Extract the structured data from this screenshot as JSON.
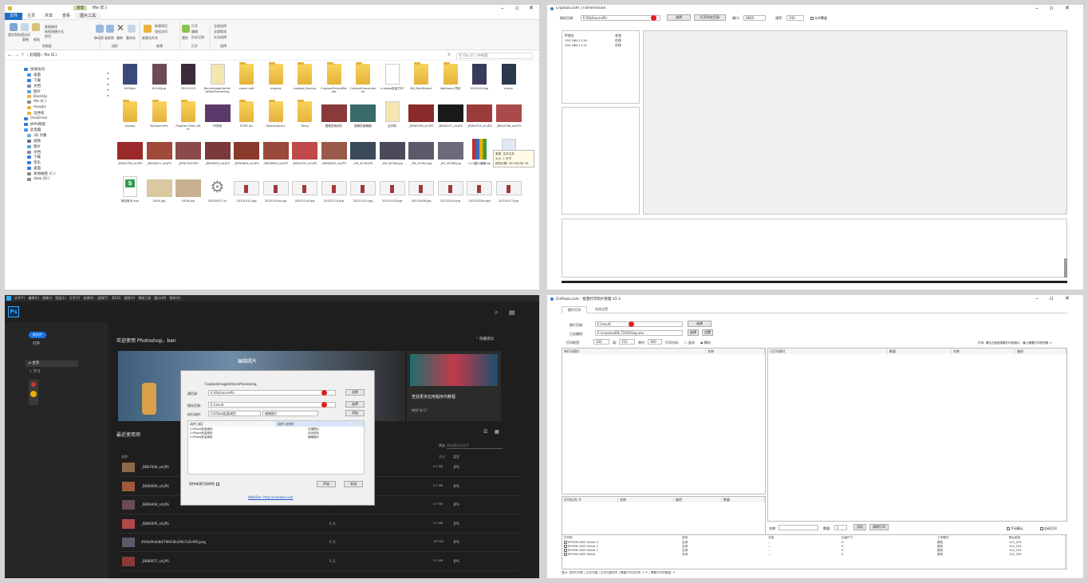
{
  "explorer": {
    "window_title": "file (E:)",
    "manage_tab": "管理",
    "ribbon_tabs": [
      "文件",
      "主页",
      "共享",
      "查看",
      "图片工具"
    ],
    "ribbon_groups": [
      "剪贴板",
      "组织",
      "新建",
      "打开",
      "选择"
    ],
    "ribbon_buttons": [
      "固定到快速访问",
      "复制",
      "粘贴",
      "复制路径",
      "粘贴快捷方式",
      "剪切",
      "移动到",
      "复制到",
      "删除",
      "重命名",
      "新建文件夹",
      "新建项目",
      "轻松访问",
      "属性",
      "打开",
      "编辑",
      "历史记录",
      "全部选择",
      "全部取消",
      "反向选择"
    ],
    "address": "› 此电脑 › file (E:)",
    "search_placeholder": "在 file (E:) 中搜索",
    "nav_items": [
      "快速访问",
      "桌面",
      "下载",
      "文档",
      "图片",
      "BackUp",
      "file (E:)",
      "mysqls",
      "证件照",
      "OneDrive",
      "WPS网盘",
      "此电脑",
      "3D 对象",
      "视频",
      "图片",
      "文档",
      "下载",
      "音乐",
      "桌面",
      "本地磁盘 (C:)",
      "data (D:)"
    ],
    "files": [
      {
        "name": "9090pic",
        "kind": "photo",
        "color": "#3b4a7a"
      },
      {
        "name": "80100jpg",
        "kind": "photo",
        "color": "#6b4a5a"
      },
      {
        "name": "20201219",
        "kind": "photo",
        "color": "#3a2a3a"
      },
      {
        "name": "BenlyImageOptimizationProcessing",
        "kind": "doc",
        "color": "#f3e6b0"
      },
      {
        "name": "canon soft",
        "kind": "folder",
        "color": "#e6b23a"
      },
      {
        "name": "cnplaza",
        "kind": "folder",
        "color": "#e6b23a"
      },
      {
        "name": "cnplaza_Backup",
        "kind": "folder",
        "color": "#e6b23a"
      },
      {
        "name": "CnplazaPictureRotate",
        "kind": "folder",
        "color": "#e6b23a"
      },
      {
        "name": "CnplazaTransmission",
        "kind": "folder",
        "color": "#e6b23a"
      },
      {
        "name": "cnplaza批量打印",
        "kind": "doc",
        "color": "#ffffff"
      },
      {
        "name": "DB_FaceDetect",
        "kind": "folder",
        "color": "#e6b23a"
      },
      {
        "name": "lightroom 预设",
        "kind": "folder",
        "color": "#e6b23a"
      },
      {
        "name": "M100100jpg",
        "kind": "photo",
        "color": "#3a3a5a"
      },
      {
        "name": "movie",
        "kind": "photo",
        "color": "#2a3a4a"
      },
      {
        "name": "mysqls",
        "kind": "folder",
        "color": "#e6b23a"
      },
      {
        "name": "MySourcePic",
        "kind": "folder",
        "color": "#e6b23a"
      },
      {
        "name": "Program Files (x86)",
        "kind": "folder",
        "color": "#e6b23a"
      },
      {
        "name": "PS预设",
        "kind": "photo",
        "color": "#5a3a6a"
      },
      {
        "name": "SONY pic",
        "kind": "folder",
        "color": "#e6b23a"
      },
      {
        "name": "SteamLibrary",
        "kind": "folder",
        "color": "#e6b23a"
      },
      {
        "name": "Temp",
        "kind": "folder",
        "color": "#e6b23a"
      },
      {
        "name": "图像匠精选件",
        "kind": "photo",
        "color": "#8a3a3a"
      },
      {
        "name": "图像匠编辑器",
        "kind": "photo",
        "color": "#3a6a6a"
      },
      {
        "name": "证件照",
        "kind": "doc",
        "color": "#f3e6b0"
      },
      {
        "name": "_BEN0198_sd.JPG",
        "kind": "photo",
        "color": "#8a2a2a"
      },
      {
        "name": "_BEN0247_sd.JPG",
        "kind": "photo",
        "color": "#1a1a1a"
      },
      {
        "name": "_BEN4751_sd.JPG",
        "kind": "photo",
        "color": "#9a3a3a"
      },
      {
        "name": "_BEN4788_sd.JPG",
        "kind": "photo",
        "color": "#aa4a4a"
      },
      {
        "name": "_BEN4798_sd.JPG",
        "kind": "photo",
        "color": "#9a2a2a"
      },
      {
        "name": "_BEN4821_sd.JPG",
        "kind": "photo",
        "color": "#a04a3a"
      },
      {
        "name": "_BEN7536.JPG",
        "kind": "photo",
        "color": "#8a4a4a"
      },
      {
        "name": "_BEN4803_sd.JPG",
        "kind": "photo",
        "color": "#7a3a3a"
      },
      {
        "name": "_BEN4804_sd.JPG",
        "kind": "photo",
        "color": "#8a3a2a"
      },
      {
        "name": "_BEN4805_sd.JPG",
        "kind": "photo",
        "color": "#9a4a3a"
      },
      {
        "name": "_BEN4790_sd.JPG",
        "kind": "photo",
        "color": "#c04a4a"
      },
      {
        "name": "_BEN4802_sd.JPG",
        "kind": "photo",
        "color": "#9a5a4a"
      },
      {
        "name": "_EN_4576.JPG",
        "kind": "photo",
        "color": "#3a4a5a"
      },
      {
        "name": "_EN_4576d.jpg",
        "kind": "photo",
        "color": "#4a4a5a"
      },
      {
        "name": "_EN_4578d.jpg",
        "kind": "photo",
        "color": "#5a5a6a"
      },
      {
        "name": "_EN_4578B.jpg",
        "kind": "photo",
        "color": "#6a6a7a"
      },
      {
        "name": "11.0图片编辑.zip",
        "kind": "zip",
        "color": "#c03030"
      },
      {
        "name": "16516812563a1",
        "kind": "doc",
        "color": "#dfe8f3"
      },
      {
        "name": "网站首页.xlsx",
        "kind": "xls",
        "color": "#2e9e4e"
      },
      {
        "name": "0426.jpg",
        "kind": "photo",
        "color": "#d9c8a0"
      },
      {
        "name": "0428.jpg",
        "kind": "photo",
        "color": "#c8b090"
      },
      {
        "name": "20200927.ini",
        "kind": "gear",
        "color": "#999999"
      },
      {
        "name": "20201010.jpg",
        "kind": "shot",
        "color": "#eeeeee"
      },
      {
        "name": "20201010a.jpg",
        "kind": "shot",
        "color": "#eeeeee"
      },
      {
        "name": "20201216.jpg",
        "kind": "shot",
        "color": "#eeeeee"
      },
      {
        "name": "20201219.jpg",
        "kind": "shot",
        "color": "#eeeeee"
      },
      {
        "name": "20210102.jpg",
        "kind": "shot",
        "color": "#eeeeee"
      },
      {
        "name": "20210103.jpg",
        "kind": "shot",
        "color": "#eeeeee"
      },
      {
        "name": "20210308.jpg",
        "kind": "shot",
        "color": "#eeeeee"
      },
      {
        "name": "20210324.jpg",
        "kind": "shot",
        "color": "#eeeeee"
      },
      {
        "name": "20210324a.jpg",
        "kind": "shot",
        "color": "#eeeeee"
      },
      {
        "name": "20210517.jpg",
        "kind": "shot",
        "color": "#eeeeee"
      }
    ],
    "tooltip": [
      "类型: 文本文件",
      "大小: 2 字节",
      "修改日期: 2019/6/08 16:"
    ]
  },
  "transmission": {
    "title": "Cnplaza.com | Transmission",
    "save_dir_label": "保存目录:",
    "save_dir_value": "E:\\MySourcePic",
    "select_btn": "选择",
    "open_dir_btn": "打开所在目录",
    "port_label": "端口:",
    "port_value": "6665",
    "speed_label": "速率:",
    "speed_value": "100",
    "overwrite_label": "允许覆盖",
    "client_headers": [
      "IP地址",
      "状态"
    ],
    "clients": [
      {
        "ip": "192.168.1.119",
        "status": "在线"
      },
      {
        "ip": "192.168.1.111",
        "status": "在线"
      }
    ]
  },
  "photoshop": {
    "menu": [
      "文件(F)",
      "编辑(E)",
      "图像(I)",
      "图层(L)",
      "文字(Y)",
      "选择(S)",
      "滤镜(T)",
      "3D(D)",
      "视图(V)",
      "增效工具",
      "窗口(W)",
      "帮助(H)"
    ],
    "logo": "Ps",
    "new_btn": "新文件",
    "open_btn": "打开",
    "side_items": [
      "主页",
      "学习"
    ],
    "welcome": "欢迎使用 Photoshop，ben",
    "hide_suggest": "隐藏建议",
    "edit_photo": "编辑照片",
    "find_more": "查找更多应用程序内教程",
    "go_learn": "转到\"学习\"",
    "recent": "最近使用项",
    "filter_label": "筛选",
    "filter_placeholder": "筛选最近的文件",
    "col_name": "名称",
    "col_size": "大小",
    "col_type": "类型",
    "recent_files": [
      {
        "name": "_BEN7600_sd.JPG",
        "time": "6 小时",
        "size": "4.5 MB",
        "type": "JPG"
      },
      {
        "name": "_BEN6660_sd.JPG",
        "time": "6 小时",
        "size": "5.1 MB",
        "type": "JPG"
      },
      {
        "name": "_BEN6494_sd.JPG",
        "time": "6 天",
        "size": "4.9 MB",
        "type": "JPG"
      },
      {
        "name": "_BEN6495_sd.JPG",
        "time": "6 天",
        "size": "5.0 MB",
        "type": "JPG"
      },
      {
        "name": "4fd4af9a0db0789038e2f6e7d2e90f.jpeg",
        "time": "6 天",
        "size": "183 KB",
        "type": "JPG"
      },
      {
        "name": "_BEN6657_sd.JPG",
        "time": "6 天",
        "size": "5.3 MB",
        "type": "JPG"
      }
    ],
    "dialog": {
      "title": "CnplazaImageActionsProcessing",
      "src_label": "源目录:",
      "src_value": "E:\\MySourcePic",
      "dst_label": "保存目录:",
      "dst_value": "E:\\result",
      "action_label": "执行动作:",
      "action_value": "CnPlaza批量调色",
      "btn_select": "选择",
      "btn_select2": "选择",
      "second_select": "缩略图片",
      "btn_add": "添加",
      "list_headers": [
        "动作 (组)",
        "动作 (名称)"
      ],
      "list_rows": [
        {
          "group": "CnPlaza批量调色",
          "name": "压缩图片"
        },
        {
          "group": "CnPlaza批量调色",
          "name": "自动锐化"
        },
        {
          "group": "CnPlaza批量调色",
          "name": "缩略图片"
        }
      ],
      "keep_structure": "保持来源目录结构",
      "btn_run": "开始",
      "btn_close": "关闭",
      "website": "WebSite: http://cnplaza.com"
    }
  },
  "printer": {
    "title": "CnPlaza.com - 批量打印照片管理 V2.3",
    "tabs": [
      "照片打印",
      "系统设置"
    ],
    "src_label": "照片目录:",
    "src_value": "E:\\result",
    "log_label": "日志路径:",
    "log_value": "E:\\cnplaza\\EN_T2020\\log.xlsx",
    "btn_select": "选择",
    "btn_select2": "选择",
    "btn_save": "设置",
    "paper_label": "打印纸型:",
    "w_value": "102",
    "h_label": "高:",
    "h_value": "152",
    "dpi_label": "单位:",
    "dpi_value": "300",
    "orient_label": "打印方向:",
    "orient_opts": [
      "竖向",
      "横向"
    ],
    "hint": "打印: 请在右侧选择要打印的照片 - 输入需要打印的张数 >",
    "left_headers": [
      "待打印照片",
      "名称"
    ],
    "right_headers": [
      "已打印照片",
      "数量",
      "名称",
      "路径"
    ],
    "queue_headers": [
      "打印队列: 0",
      "名称",
      "路径",
      "数量"
    ],
    "name_label": "名称:",
    "count_label": "数量:",
    "count_value": "1",
    "add_btn": "添加",
    "clear_btn": "清除打印",
    "auto_print": "手动确认",
    "auto_delete": "自动打印",
    "printer_headers": [
      "打印机",
      "状态",
      "文档",
      "出纸尺寸",
      "工作模式",
      "默认纸张"
    ],
    "printers": [
      {
        "name": "EPSON L805 Series 3",
        "status": "空闲",
        "doc": "...",
        "size": "0",
        "mode": "脱机",
        "paper": "102_203"
      },
      {
        "name": "EPSON L805 Series 2",
        "status": "空闲",
        "doc": "...",
        "size": "0",
        "mode": "脱机",
        "paper": "102_203"
      },
      {
        "name": "EPSON L805 Series 1",
        "status": "空闲",
        "doc": "...",
        "size": "0",
        "mode": "脱机",
        "paper": "102_203"
      },
      {
        "name": "EPSON L805 Series",
        "status": "空闲",
        "doc": "...",
        "size": "0",
        "mode": "脱机",
        "paper": "102_203"
      }
    ],
    "status_bar": "提示: 您的打印机 | 正在扫描 | 正在扫描完毕 | 需要打印文件夹: 0 个 | 需要打印的数量: 0"
  }
}
